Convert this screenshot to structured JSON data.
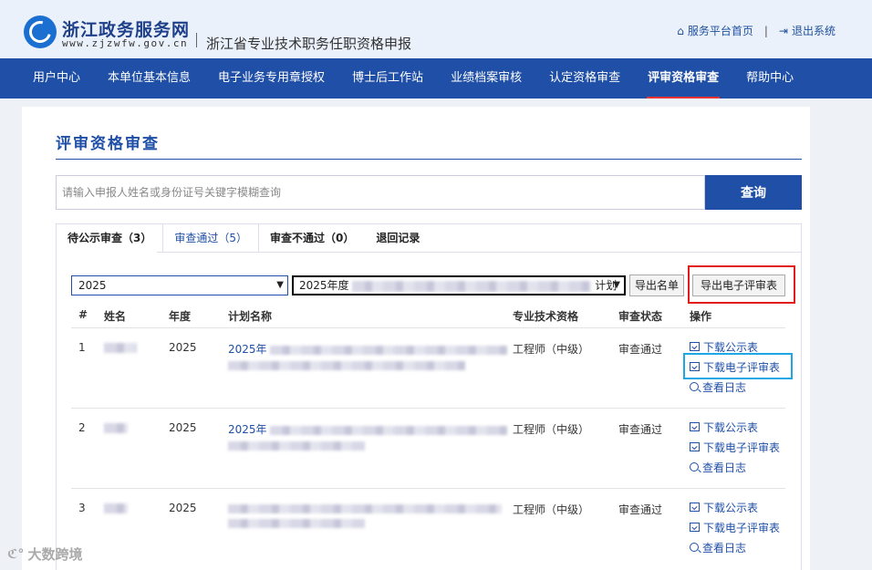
{
  "header": {
    "site_name": "浙江政务服务网",
    "site_url": "www.zjzwfw.gov.cn",
    "subtitle": "浙江省专业技术职务任职资格申报",
    "links": [
      {
        "label": "服务平台首页",
        "icon": "home-icon"
      },
      {
        "label": "退出系统",
        "icon": "logout-icon"
      }
    ],
    "link_sep": "|"
  },
  "nav": {
    "items": [
      {
        "label": "用户中心"
      },
      {
        "label": "本单位基本信息"
      },
      {
        "label": "电子业务专用章授权"
      },
      {
        "label": "博士后工作站"
      },
      {
        "label": "业绩档案审核"
      },
      {
        "label": "认定资格审查"
      },
      {
        "label": "评审资格审查",
        "active": true
      },
      {
        "label": "帮助中心"
      }
    ]
  },
  "main": {
    "title": "评审资格审查",
    "search": {
      "placeholder": "请输入申报人姓名或身份证号关键字模糊查询",
      "button": "查询"
    },
    "tabs": [
      {
        "label": "待公示审查（3）"
      },
      {
        "label": "审查通过（5）",
        "active": true
      },
      {
        "label": "审查不通过（0）"
      },
      {
        "label": "退回记录"
      }
    ],
    "filters": {
      "year": "2025",
      "plan_prefix": "2025年度",
      "plan_suffix": "计划",
      "export_list": "导出名单",
      "export_form": "导出电子评审表"
    },
    "table": {
      "headers": [
        "#",
        "姓名",
        "年度",
        "计划名称",
        "专业技术资格",
        "审查状态",
        "操作"
      ],
      "rows": [
        {
          "idx": "1",
          "year": "2025",
          "plan": "2025年",
          "qual": "工程师（中级）",
          "status": "审查通过"
        },
        {
          "idx": "2",
          "year": "2025",
          "plan": "2025年",
          "qual": "工程师（中级）",
          "status": "审查通过"
        },
        {
          "idx": "3",
          "year": "2025",
          "plan": "",
          "qual": "工程师（中级）",
          "status": "审查通过"
        }
      ],
      "ops": {
        "download_notice": "下载公示表",
        "download_form": "下载电子评审表",
        "view_log": "查看日志"
      }
    }
  },
  "watermark": "大数跨境",
  "colors": {
    "primary": "#1f4fa6",
    "highlight_red": "#e01b1b",
    "highlight_blue": "#1ea7e6"
  }
}
